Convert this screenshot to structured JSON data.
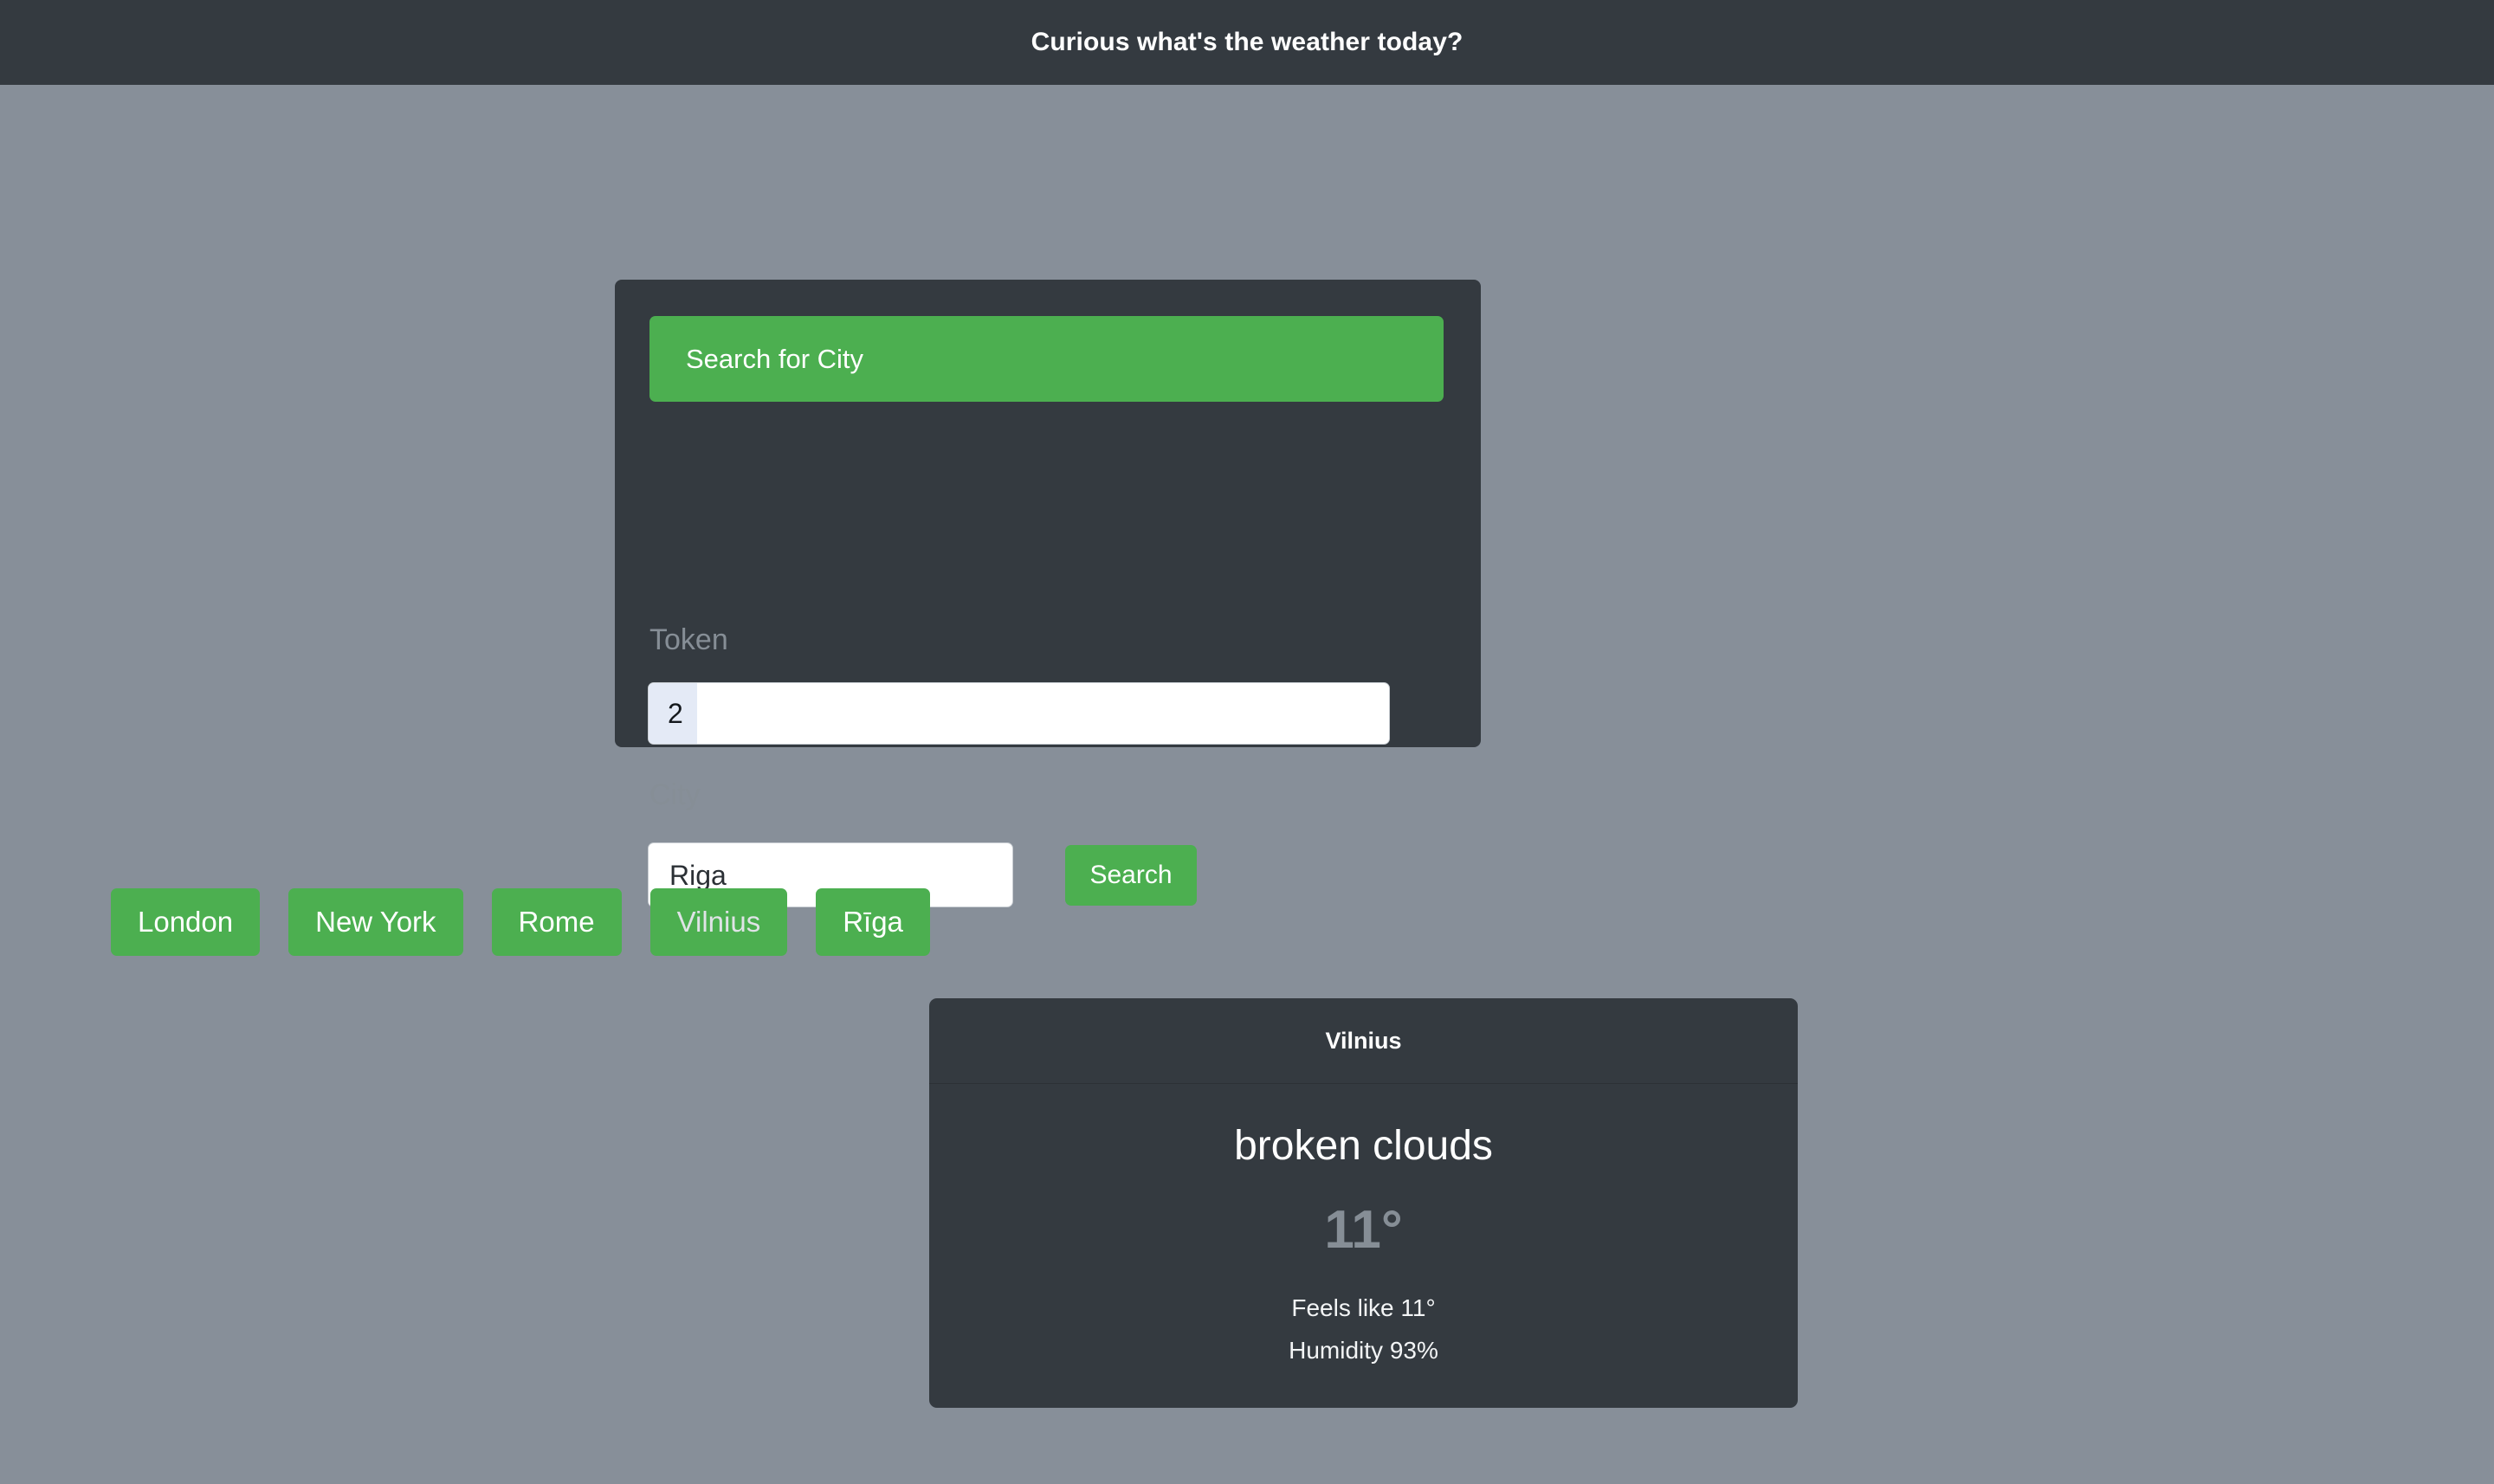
{
  "header": {
    "title": "Curious what's the weather today?"
  },
  "search_panel": {
    "banner_label": "Search for City",
    "token_label": "Token",
    "token_value": "2",
    "city_label": "City",
    "city_value": "Riga",
    "city_placeholder": "",
    "submit_label": "Search"
  },
  "quick_cities": [
    {
      "label": "London",
      "active": false
    },
    {
      "label": "New York",
      "active": false
    },
    {
      "label": "Rome",
      "active": false
    },
    {
      "label": "Vilnius",
      "active": true
    },
    {
      "label": "Rīga",
      "active": false
    }
  ],
  "weather_card": {
    "city": "Vilnius",
    "condition": "broken clouds",
    "temperature": "11°",
    "feels_like": "Feels like 11°",
    "humidity": "Humidity 93%"
  },
  "colors": {
    "page_background": "#878f99",
    "panel": "#343a40",
    "accent_green": "#4CAF50",
    "muted_text": "#868e96",
    "white_text": "#ffffff",
    "input_selection": "#e4eaf6"
  }
}
